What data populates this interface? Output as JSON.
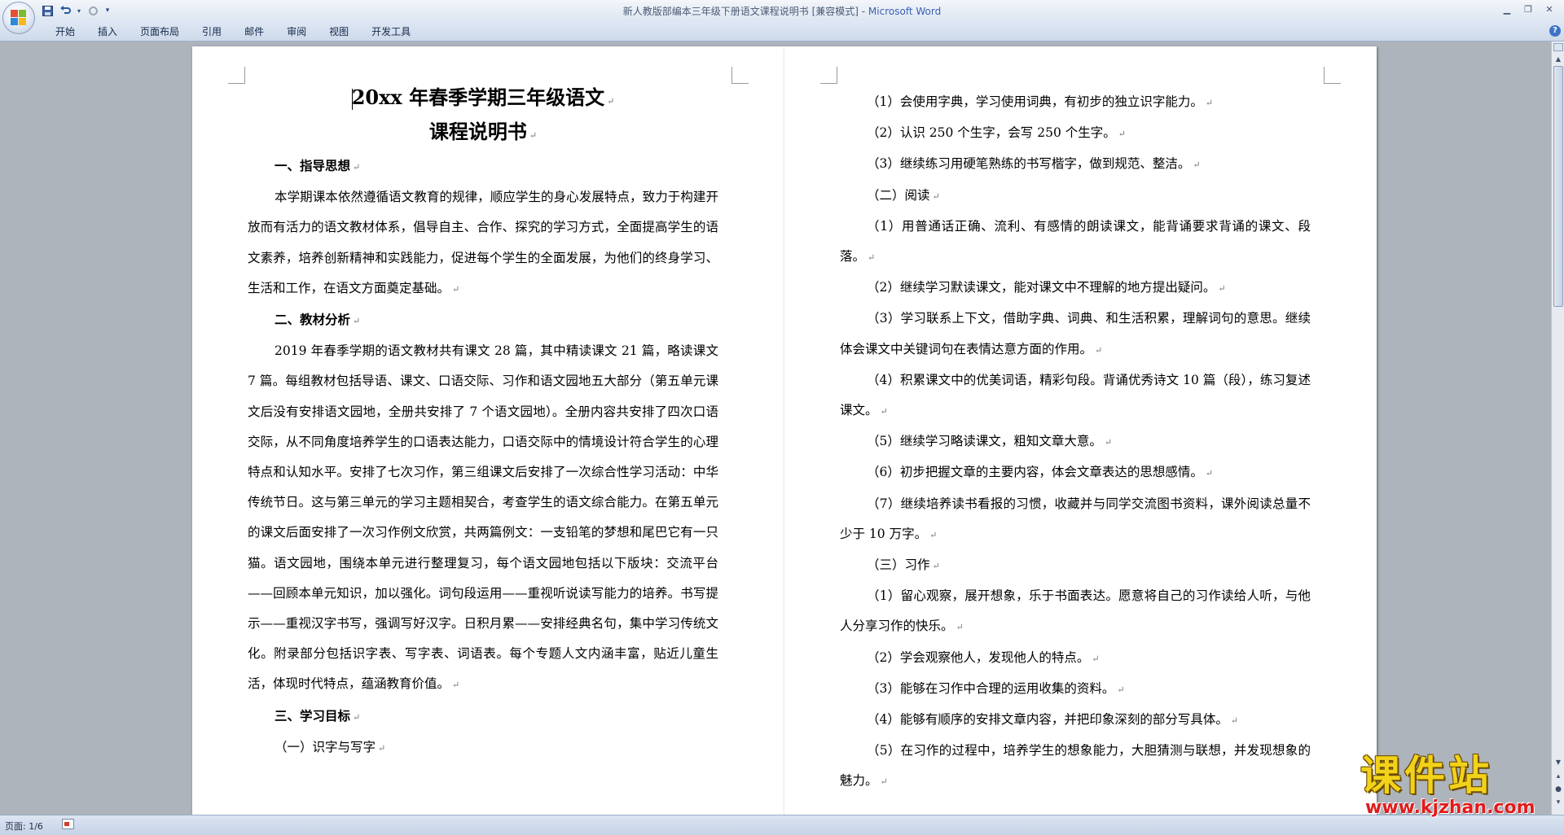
{
  "window": {
    "title": "新人教版部编本三年级下册语文课程说明书 [兼容模式] - ",
    "app_name": "Microsoft Word"
  },
  "qat": {
    "save_icon": "save-icon",
    "undo_icon": "undo-icon",
    "redo_icon": "redo-icon",
    "customize_icon": "dropdown-icon"
  },
  "ribbon": {
    "tabs": [
      "开始",
      "插入",
      "页面布局",
      "引用",
      "邮件",
      "审阅",
      "视图",
      "开发工具"
    ]
  },
  "page1": {
    "title_line1": "20xx 年春季学期三年级语文",
    "title_line2": "课程说明书",
    "paragraphs": [
      {
        "text": "一、指导思想",
        "heading": true
      },
      {
        "text": "本学期课本依然遵循语文教育的规律，顺应学生的身心发展特点，致力于构建开放而有活力的语文教材体系，倡导自主、合作、探究的学习方式，全面提高学生的语文素养，培养创新精神和实践能力，促进每个学生的全面发展，为他们的终身学习、生活和工作，在语文方面奠定基础。",
        "heading": false
      },
      {
        "text": "二、教材分析",
        "heading": true
      },
      {
        "text": "2019 年春季学期的语文教材共有课文 28 篇，其中精读课文 21 篇，略读课文 7 篇。每组教材包括导语、课文、口语交际、习作和语文园地五大部分（第五单元课文后没有安排语文园地，全册共安排了 7 个语文园地）。全册内容共安排了四次口语交际，从不同角度培养学生的口语表达能力，口语交际中的情境设计符合学生的心理特点和认知水平。安排了七次习作，第三组课文后安排了一次综合性学习活动：中华传统节日。这与第三单元的学习主题相契合，考查学生的语文综合能力。在第五单元的课文后面安排了一次习作例文欣赏，共两篇例文：一支铅笔的梦想和尾巴它有一只猫。语文园地，围绕本单元进行整理复习，每个语文园地包括以下版块：交流平台——回顾本单元知识，加以强化。词句段运用——重视听说读写能力的培养。书写提示——重视汉字书写，强调写好汉字。日积月累——安排经典名句，集中学习传统文化。附录部分包括识字表、写字表、词语表。每个专题人文内涵丰富，贴近儿童生活，体现时代特点，蕴涵教育价值。",
        "heading": false
      },
      {
        "text": "三、学习目标",
        "heading": true
      },
      {
        "text": "（一）识字与写字",
        "heading": false
      }
    ]
  },
  "page2": {
    "paragraphs": [
      "（1）会使用字典，学习使用词典，有初步的独立识字能力。",
      "（2）认识 250 个生字，会写 250 个生字。",
      "（3）继续练习用硬笔熟练的书写楷字，做到规范、整洁。",
      "（二）阅读",
      "（1）用普通话正确、流利、有感情的朗读课文，能背诵要求背诵的课文、段落。",
      "（2）继续学习默读课文，能对课文中不理解的地方提出疑问。",
      "（3）学习联系上下文，借助字典、词典、和生活积累，理解词句的意思。继续体会课文中关键词句在表情达意方面的作用。",
      "（4）积累课文中的优美词语，精彩句段。背诵优秀诗文 10 篇（段），练习复述课文。",
      "（5）继续学习略读课文，粗知文章大意。",
      "（6）初步把握文章的主要内容，体会文章表达的思想感情。",
      "（7）继续培养读书看报的习惯，收藏并与同学交流图书资料，课外阅读总量不少于 10 万字。",
      "（三）习作",
      "（1）留心观察，展开想象，乐于书面表达。愿意将自己的习作读给人听，与他人分享习作的快乐。",
      "（2）学会观察他人，发现他人的特点。",
      "（3）能够在习作中合理的运用收集的资料。",
      "（4）能够有顺序的安排文章内容，并把印象深刻的部分写具体。",
      "（5）在习作的过程中，培养学生的想象能力，大胆猜测与联想，并发现想象的魅力。"
    ]
  },
  "status": {
    "page_label": "页面: 1/6"
  },
  "watermark": {
    "logo_text": "课件站",
    "url": "www.kjzhan.com"
  },
  "colors": {
    "ribbon": "#d5e1f0",
    "background": "#aeb4bc",
    "watermark_yellow": "#f2d21a",
    "watermark_red": "#e21b1b"
  }
}
